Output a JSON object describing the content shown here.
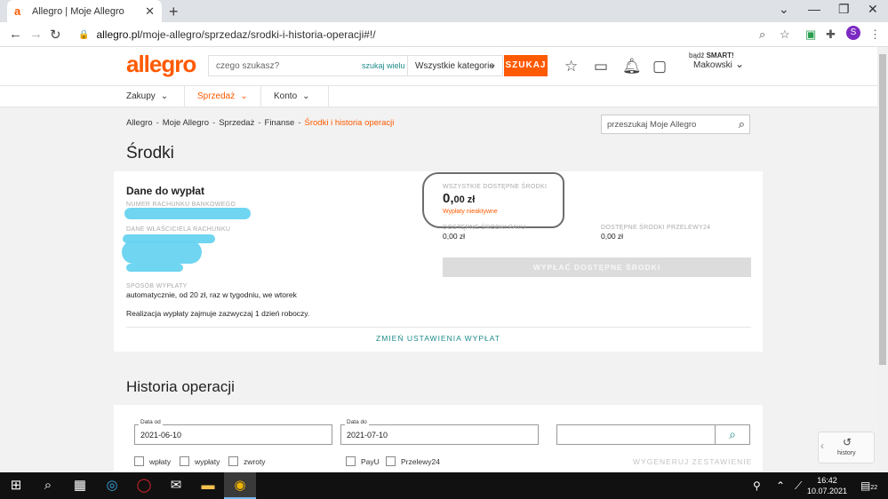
{
  "browser": {
    "tab_title": "Allegro | Moje Allegro",
    "tab_favicon": "a",
    "url_host": "allegro.pl",
    "url_path": "/moje-allegro/sprzedaz/srodki-i-historia-operacji#!/",
    "profile_initial": "S"
  },
  "header": {
    "logo": "allegro",
    "search_placeholder": "czego szukasz?",
    "search_many": "szukaj wielu",
    "category": "Wszystkie kategorie",
    "search_button": "SZUKAJ",
    "smart_prefix": "bądź",
    "smart_word": "SMART!",
    "user_name": "Makowski"
  },
  "subnav": [
    {
      "label": "Zakupy"
    },
    {
      "label": "Sprzedaż"
    },
    {
      "label": "Konto"
    }
  ],
  "breadcrumb": [
    "Allegro",
    "Moje Allegro",
    "Sprzedaż",
    "Finanse",
    "Środki i historia operacji"
  ],
  "breadcrumb_sep": "-",
  "my_search_placeholder": "przeszukaj Moje Allegro",
  "page_title": "Środki",
  "payout": {
    "title": "Dane do wypłat",
    "bank_account_label": "NUMER RACHUNKU BANKOWEGO",
    "owner_label": "DANE WŁAŚCICIELA RACHUNKU",
    "method_label": "SPOSÓB WYPŁATY",
    "method_value": "automatycznie, od 20 zł, raz w tygodniu, we wtorek",
    "realization_note": "Realizacja wypłaty zajmuje zazwyczaj 1 dzień roboczy.",
    "change_link": "ZMIEŃ USTAWIENIA WYPŁAT"
  },
  "funds": {
    "total_label": "WSZYSTKIE DOSTĘPNE ŚRODKI",
    "total_int": "0,",
    "total_dec": "00 zł",
    "inactive_note": "Wypłaty nieaktywne",
    "payu_label": "DOSTĘPNE ŚRODKI PAYU",
    "payu_value": "0,00 zł",
    "p24_label": "DOSTĘPNE ŚRODKI PRZELEWY24",
    "p24_value": "0,00 zł",
    "payout_button": "WYPŁAĆ DOSTĘPNE ŚRODKI"
  },
  "history": {
    "title": "Historia operacji",
    "date_from_label": "Data od",
    "date_from": "2021-06-10",
    "date_to_label": "Data do",
    "date_to": "2021-07-10",
    "checkboxes": [
      "wpłaty",
      "wypłaty",
      "zwroty",
      "PayU",
      "Przelewy24"
    ],
    "generate_report": "WYGENERUJ ZESTAWIENIE"
  },
  "history_widget_label": "history",
  "taskbar": {
    "time": "16:42",
    "date": "10.07.2021",
    "notifications": "22"
  },
  "colors": {
    "brand": "#ff5a00",
    "link": "#1f8a8a"
  }
}
